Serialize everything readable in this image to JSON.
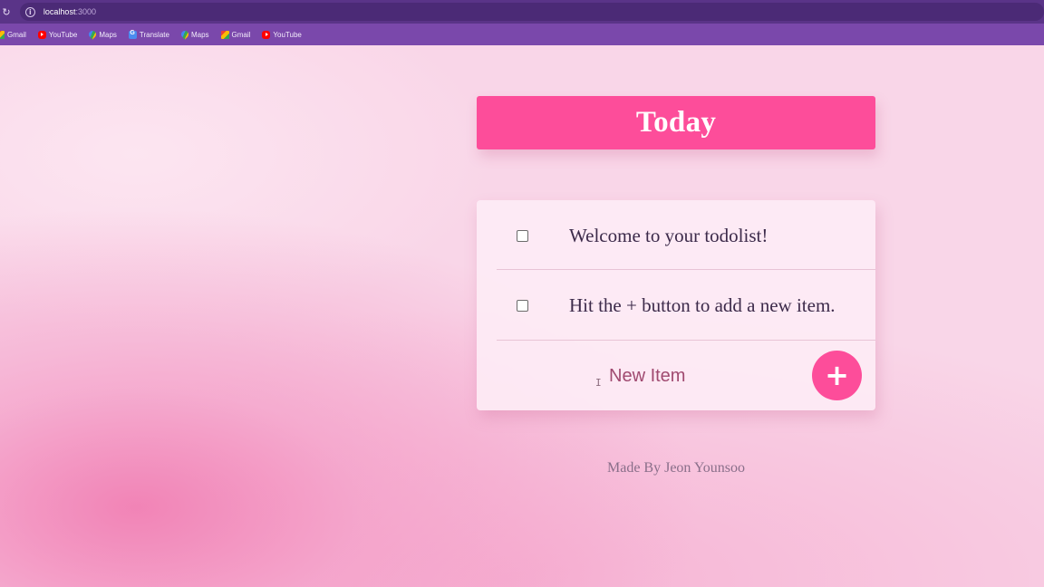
{
  "browser": {
    "url_host": "localhost",
    "url_port": ":3000",
    "bookmarks": [
      {
        "label": "Gmail",
        "icon": "gmail-icon"
      },
      {
        "label": "YouTube",
        "icon": "youtube-icon"
      },
      {
        "label": "Maps",
        "icon": "maps-icon"
      },
      {
        "label": "Translate",
        "icon": "translate-icon"
      },
      {
        "label": "Maps",
        "icon": "maps-icon"
      },
      {
        "label": "Gmail",
        "icon": "gmail-icon"
      },
      {
        "label": "YouTube",
        "icon": "youtube-icon"
      }
    ]
  },
  "app": {
    "title": "Today",
    "items": [
      {
        "text": "Welcome to your todolist!",
        "checked": false
      },
      {
        "text": "Hit the + button to add a new item.",
        "checked": false
      }
    ],
    "new_item_placeholder": "New Item",
    "add_button_label": "+",
    "footer": "Made By Jeon Younsoo"
  },
  "colors": {
    "accent": "#fd4d9a",
    "card": "#fdecf5",
    "background": "#f9d6e8",
    "browser_bar": "#5a3488",
    "bookmark_bar": "#7a48ab"
  }
}
